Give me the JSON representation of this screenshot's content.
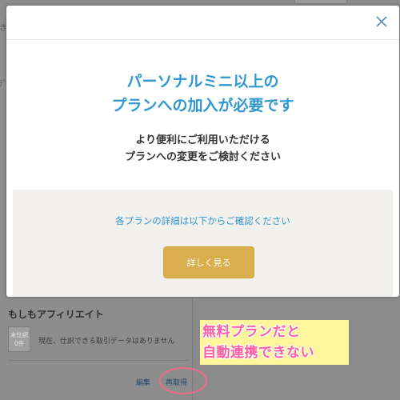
{
  "background": {
    "left_text_fragments": [
      "き",
      "ﾃﾞ"
    ],
    "service_card": {
      "name": "もしもアフィリエイト",
      "status_badge": {
        "label": "未仕訳",
        "count": "0件"
      },
      "status_text": "現在、仕訳できる取引データはありません",
      "edit_link": "編集",
      "reacquire_link": "再取得"
    },
    "annotation": {
      "lines": [
        "無料プランだと",
        "自動連携できない"
      ],
      "highlight_color": "#fff59a",
      "text_color": "#ff5fa2",
      "circle_color": "#f06b8b"
    }
  },
  "modal": {
    "title_lines": [
      "パーソナルミニ以上の",
      "プランへの加入が必要です"
    ],
    "description_lines": [
      "より便利にご利用いただける",
      "プランへの変更をご検討ください"
    ],
    "footer_text": "各プランの詳細は以下からご確認ください",
    "cta_label": "詳しく見る",
    "close_icon": "close-icon",
    "accent_color": "#2f97d0",
    "cta_color": "#d9ae4c"
  }
}
